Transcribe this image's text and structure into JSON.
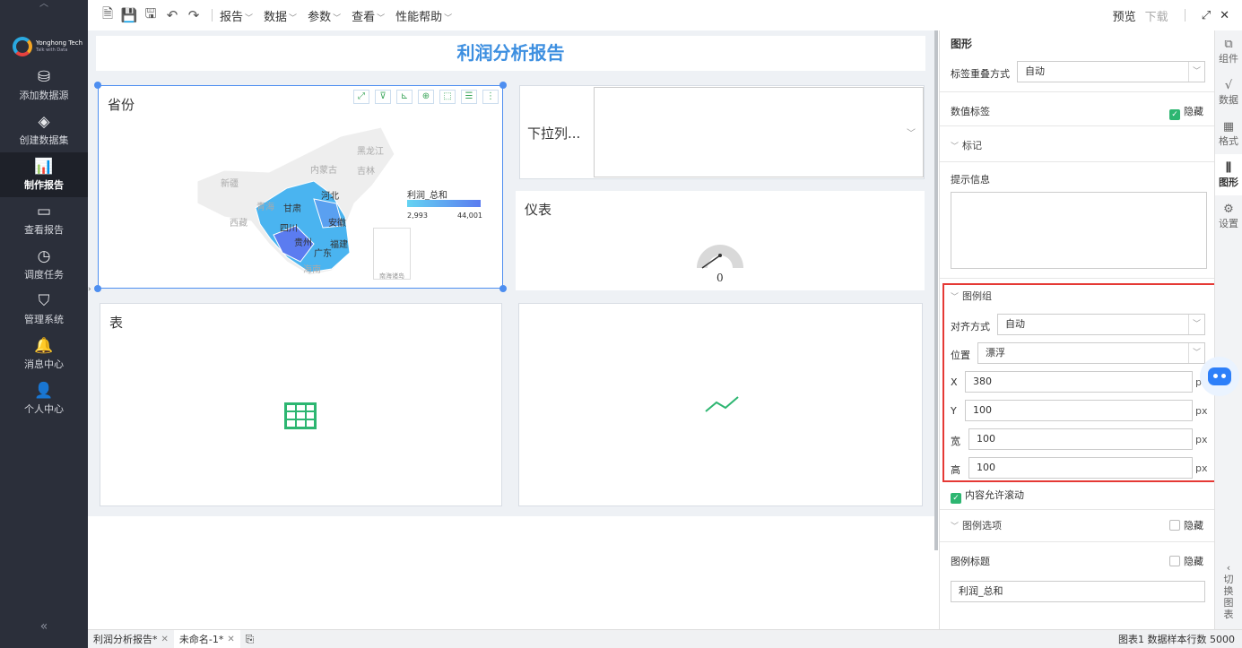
{
  "sidebar": {
    "logo_name": "Yonghong Tech",
    "logo_tagline": "Talk with Data",
    "items": [
      {
        "label": "添加数据源",
        "icon": "database-icon"
      },
      {
        "label": "创建数据集",
        "icon": "layers-icon"
      },
      {
        "label": "制作报告",
        "icon": "chart-report-icon",
        "active": true
      },
      {
        "label": "查看报告",
        "icon": "monitor-chart-icon"
      },
      {
        "label": "调度任务",
        "icon": "clock-icon"
      },
      {
        "label": "管理系统",
        "icon": "shield-icon"
      },
      {
        "label": "消息中心",
        "icon": "bell-icon"
      },
      {
        "label": "个人中心",
        "icon": "user-icon"
      }
    ],
    "collapse_glyph": "«"
  },
  "toolbar": {
    "menus": [
      "报告",
      "数据",
      "参数",
      "查看",
      "性能帮助"
    ],
    "preview": "预览",
    "download": "下载"
  },
  "report": {
    "title": "利润分析报告",
    "map": {
      "title": "省份",
      "legend_title": "利润_总和",
      "legend_min": "2,993",
      "legend_max": "44,001",
      "labels": {
        "heilongjiang": "黑龙江",
        "jilin": "吉林",
        "neimenggu": "内蒙古",
        "xinjiang": "新疆",
        "hebei": "河北",
        "gansu": "甘肃",
        "qinghai": "青海",
        "xizang": "西藏",
        "sichuan": "四川",
        "anhui": "安徽",
        "guizhou": "贵州",
        "fujian": "福建",
        "guangdong": "广东",
        "hainan": "海南",
        "nanhai": "南海诸岛"
      }
    },
    "dropdown": {
      "label": "下拉列..."
    },
    "gauge": {
      "title": "仪表",
      "value": "0"
    },
    "table": {
      "title": "表"
    }
  },
  "props": {
    "section": "图形",
    "label_overlap": {
      "label": "标签重叠方式",
      "value": "自动"
    },
    "value_label": {
      "label": "数值标签",
      "hide": "隐藏"
    },
    "marks": "标记",
    "tooltip": "提示信息",
    "legend_group": {
      "title": "图例组",
      "align": {
        "label": "对齐方式",
        "value": "自动"
      },
      "position": {
        "label": "位置",
        "value": "漂浮"
      },
      "x": {
        "label": "X",
        "value": "380",
        "unit": "px"
      },
      "y": {
        "label": "Y",
        "value": "100",
        "unit": "px"
      },
      "width": {
        "label": "宽",
        "value": "100",
        "unit": "px"
      },
      "height": {
        "label": "高",
        "value": "100",
        "unit": "px"
      }
    },
    "allow_scroll": "内容允许滚动",
    "legend_options": {
      "title": "图例选项",
      "hide": "隐藏"
    },
    "legend_title": {
      "label": "图例标题",
      "hide": "隐藏",
      "value": "利润_总和"
    }
  },
  "tabs": [
    "组件",
    "数据",
    "格式",
    "图形",
    "设置"
  ],
  "switch_chart": "切换图表",
  "statusbar": {
    "files": [
      {
        "name": "利润分析报告*"
      },
      {
        "name": "未命名-1*"
      }
    ],
    "right": "图表1  数据样本行数 5000"
  }
}
